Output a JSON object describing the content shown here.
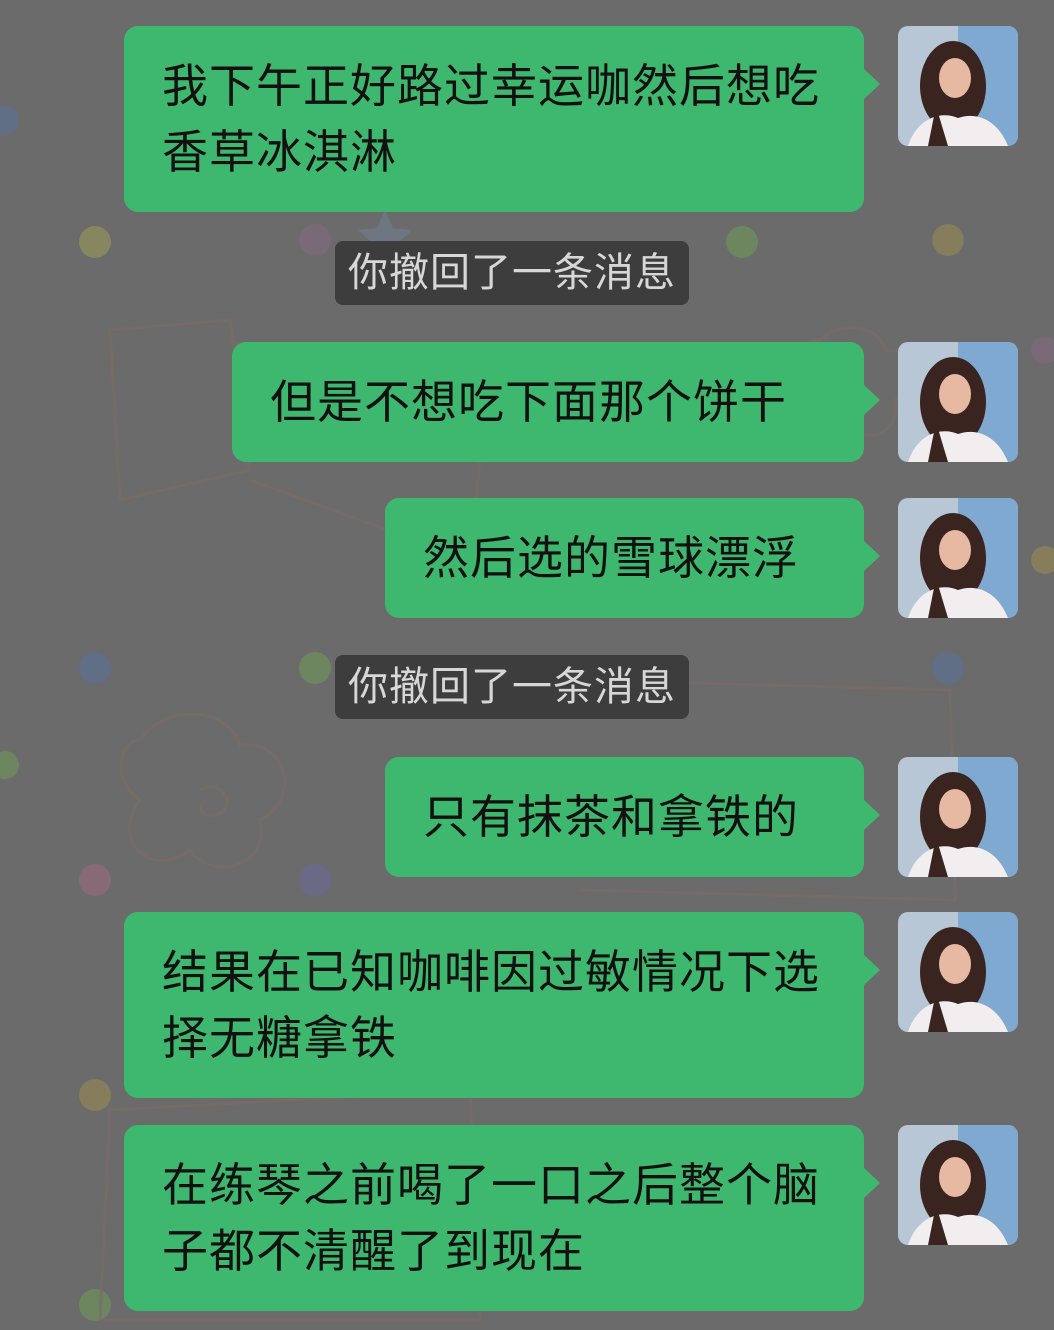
{
  "theme": {
    "bubble_color": "#3fb86f",
    "system_notice_bg": "#3d3d3d",
    "wallpaper_dim": "#6b6b6b"
  },
  "messages": [
    {
      "kind": "outgoing",
      "text": "我下午正好路过幸运咖然后想吃香草冰淇淋"
    },
    {
      "kind": "system",
      "text": "你撤回了一条消息"
    },
    {
      "kind": "outgoing",
      "text": "但是不想吃下面那个饼干"
    },
    {
      "kind": "outgoing",
      "text": "然后选的雪球漂浮"
    },
    {
      "kind": "system",
      "text": "你撤回了一条消息"
    },
    {
      "kind": "outgoing",
      "text": "只有抹茶和拿铁的"
    },
    {
      "kind": "outgoing",
      "text": "结果在已知咖啡因过敏情况下选择无糖拿铁"
    },
    {
      "kind": "outgoing",
      "text": "在练琴之前喝了一口之后整个脑子都不清醒了到现在"
    }
  ],
  "avatar_icon": "user-avatar-photo"
}
